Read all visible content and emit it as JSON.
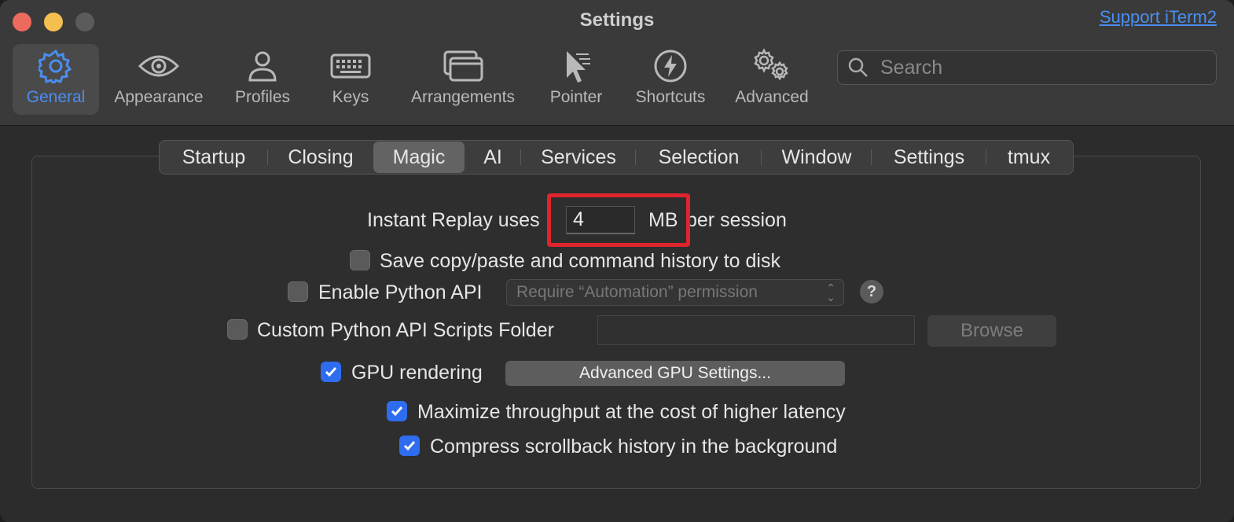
{
  "window": {
    "title": "Settings",
    "support_link": "Support iTerm2"
  },
  "toolbar": {
    "items": [
      {
        "label": "General",
        "icon": "gear-icon",
        "active": true
      },
      {
        "label": "Appearance",
        "icon": "eye-icon",
        "active": false
      },
      {
        "label": "Profiles",
        "icon": "person-icon",
        "active": false
      },
      {
        "label": "Keys",
        "icon": "keyboard-icon",
        "active": false
      },
      {
        "label": "Arrangements",
        "icon": "windows-icon",
        "active": false
      },
      {
        "label": "Pointer",
        "icon": "pointer-icon",
        "active": false
      },
      {
        "label": "Shortcuts",
        "icon": "bolt-icon",
        "active": false
      },
      {
        "label": "Advanced",
        "icon": "gears-icon",
        "active": false
      }
    ],
    "search": {
      "placeholder": "Search",
      "value": ""
    }
  },
  "tabs": [
    {
      "label": "Startup",
      "active": false
    },
    {
      "label": "Closing",
      "active": false
    },
    {
      "label": "Magic",
      "active": true
    },
    {
      "label": "AI",
      "active": false
    },
    {
      "label": "Services",
      "active": false
    },
    {
      "label": "Selection",
      "active": false
    },
    {
      "label": "Window",
      "active": false
    },
    {
      "label": "Settings",
      "active": false
    },
    {
      "label": "tmux",
      "active": false
    }
  ],
  "magic": {
    "instant_replay": {
      "label_before": "Instant Replay uses",
      "value": "4",
      "unit": "MB",
      "label_after": "per session"
    },
    "save_history": {
      "label": "Save copy/paste and command history to disk",
      "checked": false
    },
    "python_api": {
      "label": "Enable Python API",
      "checked": false,
      "permission_value": "Require “Automation” permission",
      "help": "?"
    },
    "custom_scripts": {
      "label": "Custom Python API Scripts Folder",
      "checked": false,
      "path": "",
      "browse": "Browse"
    },
    "gpu": {
      "label": "GPU rendering",
      "checked": true,
      "button": "Advanced GPU Settings..."
    },
    "throughput": {
      "label": "Maximize throughput at the cost of higher latency",
      "checked": true
    },
    "compress": {
      "label": "Compress scrollback history in the background",
      "checked": true
    }
  },
  "colors": {
    "accent": "#4a8ef0",
    "checkbox_on": "#2f6df0",
    "highlight": "#e0242d"
  }
}
